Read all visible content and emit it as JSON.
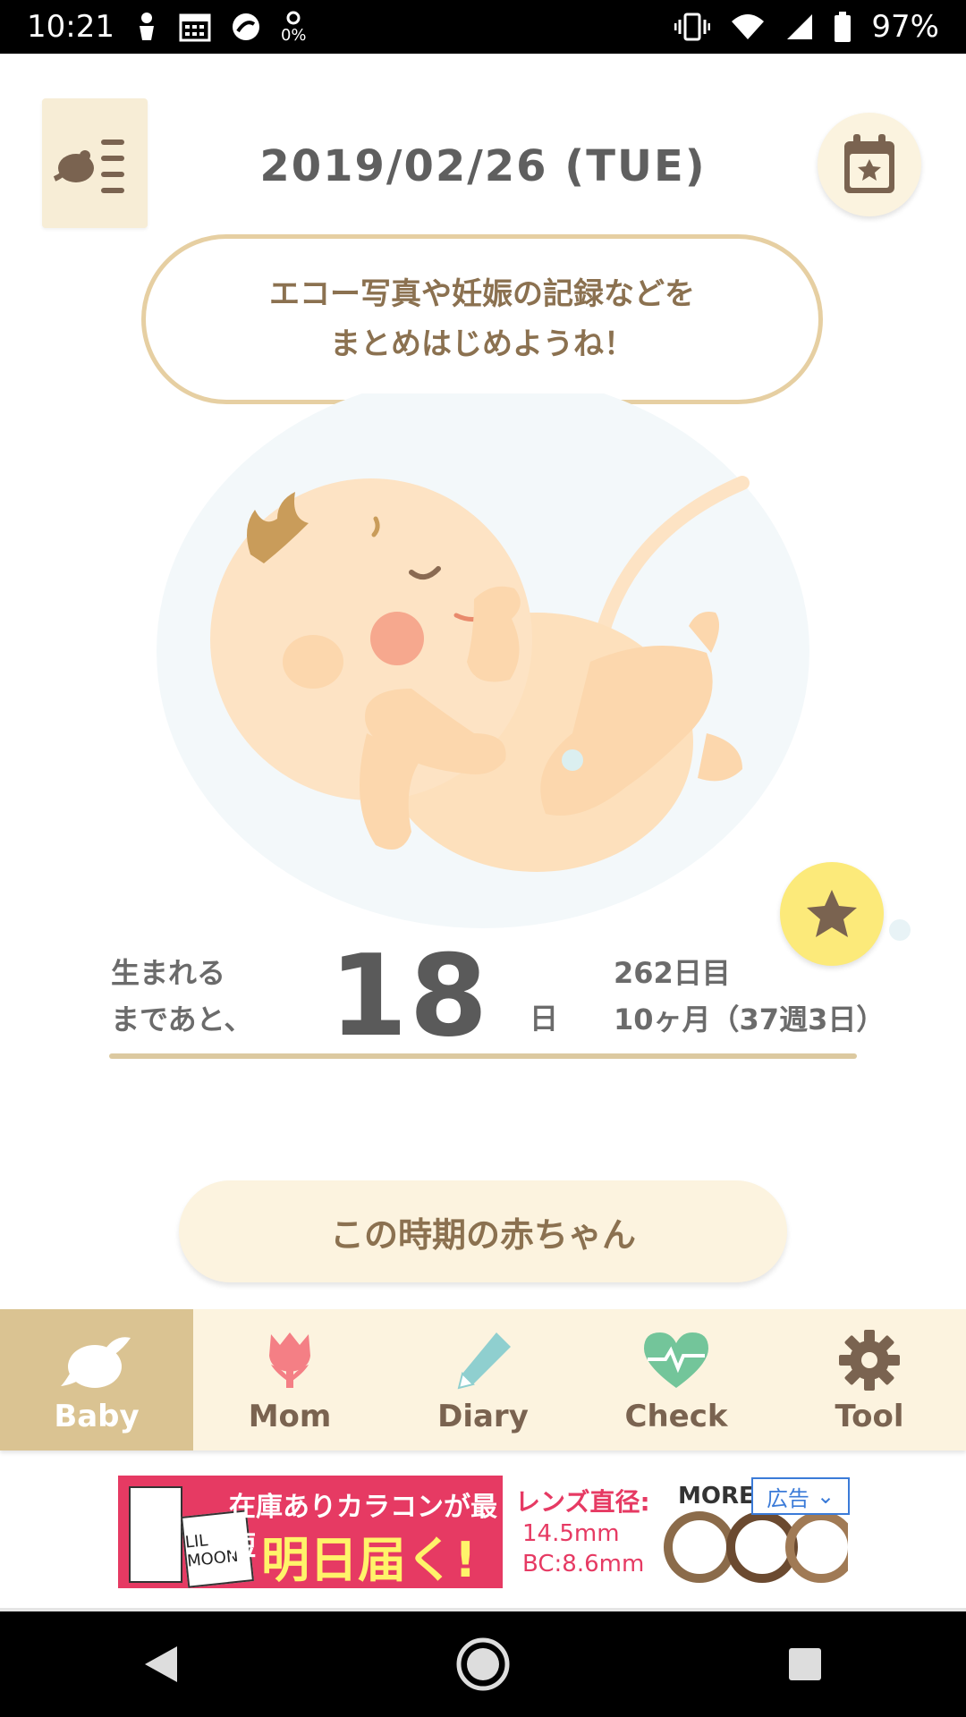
{
  "status_bar": {
    "time": "10:21",
    "battery": "97%",
    "small_icon_text": "0%"
  },
  "header": {
    "date": "2019/02/26 (TUE)"
  },
  "bubble": {
    "line1": "エコー写真や妊娠の記録などを",
    "line2": "まとめはじめようね！"
  },
  "countdown": {
    "left_line1": "生まれる",
    "left_line2": "まであと、",
    "days": "18",
    "unit": "日",
    "day_count": "262日目",
    "month_week": "10ヶ月（37週3日）"
  },
  "period_button": "この時期の赤ちゃん",
  "tabs": [
    {
      "label": "Baby",
      "icon": "bird-icon",
      "active": true
    },
    {
      "label": "Mom",
      "icon": "tulip-icon",
      "active": false
    },
    {
      "label": "Diary",
      "icon": "pencil-icon",
      "active": false
    },
    {
      "label": "Check",
      "icon": "heartbeat-icon",
      "active": false
    },
    {
      "label": "Tool",
      "icon": "gear-icon",
      "active": false
    }
  ],
  "ad": {
    "line1": "在庫ありカラコンが最短",
    "line2": "明日届く!",
    "right_title": "レンズ直径:",
    "right_spec1": "14.5mm",
    "right_spec2": "BC:8.6mm",
    "brand": "MORE",
    "box_text": "LIL MOON",
    "tag": "広告"
  },
  "colors": {
    "accent_beige": "#dac392",
    "cream": "#fcf3df",
    "star_yellow": "#fcea7a",
    "ad_pink": "#e63a63"
  }
}
